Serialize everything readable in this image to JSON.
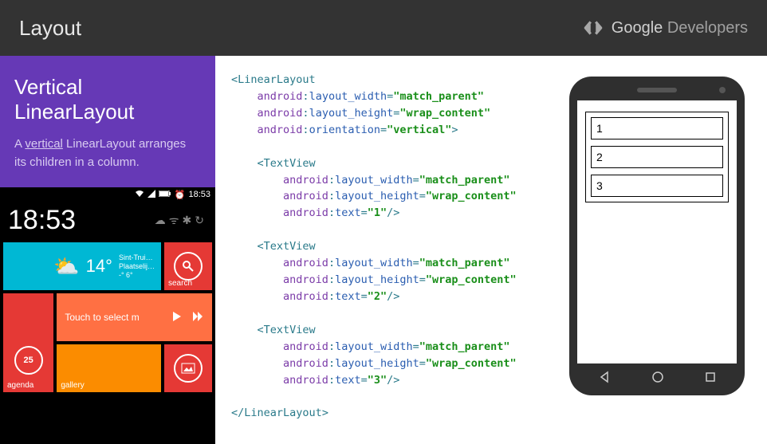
{
  "header": {
    "title": "Layout",
    "brand_google": "Google",
    "brand_dev": " Developers"
  },
  "sidebar": {
    "heading_l1": "Vertical",
    "heading_l2": "LinearLayout",
    "desc_pre": "A ",
    "desc_u": "vertical",
    "desc_post": " LinearLayout arranges its children in a column."
  },
  "mock": {
    "status_time": "18:53",
    "big_clock": "18:53",
    "weather_temp": "14°",
    "weather_loc": "Sint-Trui…",
    "weather_cond": "Plaatselij…",
    "weather_range": "-° 6°",
    "search_label": "search",
    "agenda_label": "agenda",
    "music_text": "Touch to select m",
    "gallery_label": "gallery"
  },
  "code": {
    "tag_linearlayout": "LinearLayout",
    "tag_textview": "TextView",
    "ns_android": "android",
    "attr_width": "layout_width",
    "attr_height": "layout_height",
    "attr_orient": "orientation",
    "attr_text": "text",
    "val_match": "\"match_parent\"",
    "val_wrap": "\"wrap_content\"",
    "val_vert": "\"vertical\"",
    "val_1": "\"1\"",
    "val_2": "\"2\"",
    "val_3": "\"3\""
  },
  "phone": {
    "box1": "1",
    "box2": "2",
    "box3": "3"
  }
}
